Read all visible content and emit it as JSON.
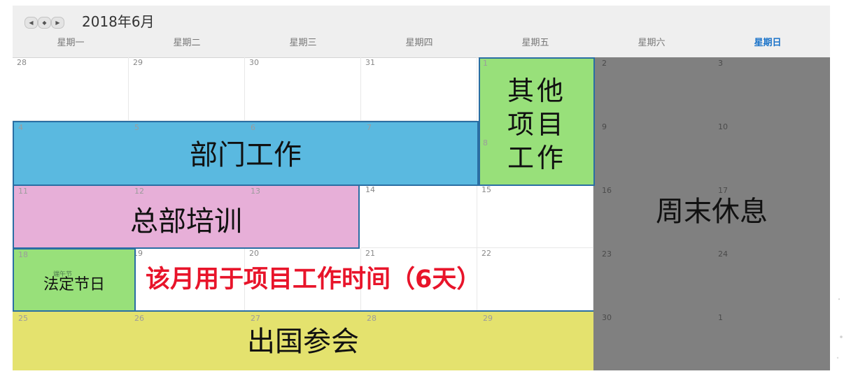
{
  "toolbar": {
    "prev_icon": "◀",
    "today_icon": "◆",
    "next_icon": "▶",
    "month_title": "2018年6月"
  },
  "weekdays": [
    "星期一",
    "星期二",
    "星期三",
    "星期四",
    "星期五",
    "星期六",
    "星期日"
  ],
  "weeks": [
    [
      "28",
      "29",
      "30",
      "31",
      "1",
      "2",
      "3"
    ],
    [
      "4",
      "5",
      "6",
      "7",
      "8",
      "9",
      "10"
    ],
    [
      "11",
      "12",
      "13",
      "14",
      "15",
      "16",
      "17"
    ],
    [
      "18",
      "19",
      "20",
      "21",
      "22",
      "23",
      "24"
    ],
    [
      "25",
      "26",
      "27",
      "28",
      "29",
      "30",
      "1"
    ]
  ],
  "blocks": {
    "other_project": "其他\n项目\n工作",
    "department": "部门工作",
    "hq_training": "总部培训",
    "weekend": "周末休息",
    "holiday": "法定节日",
    "abroad": "出国参会"
  },
  "holiday_tag": "端午节",
  "note": "该月用于项目工作时间（6天）",
  "colors": {
    "weekend": "#808080",
    "department": "#5ab9e0",
    "other_project": "#98e07a",
    "training": "#e7afd8",
    "abroad": "#e4e26e",
    "note": "#e8142a",
    "active_weekday": "#1a73c9"
  }
}
